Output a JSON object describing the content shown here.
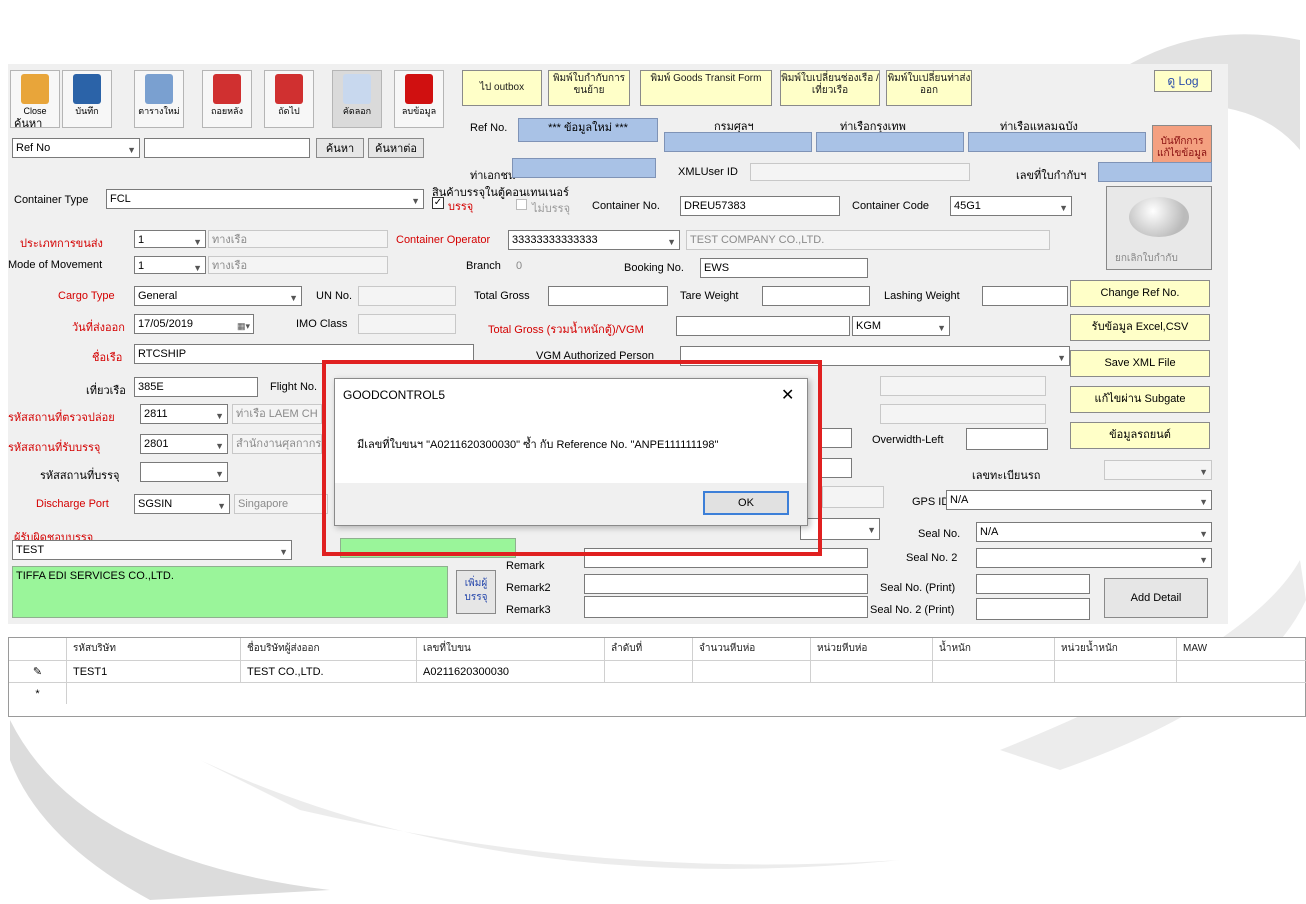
{
  "toolbar": [
    {
      "label": "Close",
      "icon": "close-folder-icon",
      "color": "#e8a53a"
    },
    {
      "label": "บันทึก",
      "icon": "save-icon",
      "color": "#2b63a8"
    },
    {
      "label": "ตารางใหม่",
      "icon": "edit-icon",
      "color": "#7aa0d0"
    },
    {
      "label": "ถอยหลัง",
      "icon": "back-arrow-icon",
      "color": "#d03030"
    },
    {
      "label": "ถัดไป",
      "icon": "next-arrow-icon",
      "color": "#d03030"
    },
    {
      "label": "คัดลอก",
      "icon": "copy-icon",
      "color": "#c8d8ee"
    },
    {
      "label": "ลบข้อมูล",
      "icon": "delete-x-icon",
      "color": "#d01010"
    }
  ],
  "top_buttons": {
    "outbox": "ไป outbox",
    "print_cargo": "พิมพ์ใบกำกับการขนย้าย",
    "print_goods_transit": "พิมพ์ Goods Transit Form",
    "print_change_port": "พิมพ์ใบเปลี่ยนช่องเรือ /เที่ยวเรือ",
    "print_change_exit": "พิมพ์ใบเปลี่ยนท่าส่งออก",
    "log": "ดู Log",
    "save_edit": "บันทึกการแก้ไขข้อมูล"
  },
  "search": {
    "label": "ค้นหา",
    "field": "Ref No",
    "value": "",
    "search_btn": "ค้นหา",
    "advanced_btn": "ค้นหาต่อ"
  },
  "header": {
    "ref_label": "Ref No.",
    "ref_value": "*** ข้อมูลใหม่ ***",
    "col1": "กรมศุลฯ",
    "col2": "ท่าเรือกรุงเทพ",
    "col3": "ท่าเรือแหลมฉบัง",
    "agent_label": "ท่าเอกชน",
    "xml_user_label": "XMLUser ID",
    "permit_label": "เลขที่ใบกำกับฯ"
  },
  "container": {
    "type_label": "Container Type",
    "type_value": "FCL",
    "goods_label": "สินค้าบรรจุในตู้คอนเทนเนอร์",
    "packed_label": "บรรจุ",
    "bulk_label": "ไม่บรรจุ",
    "no_label": "Container No.",
    "no_value": "DREU57383",
    "code_label": "Container Code",
    "code_value": "45G1",
    "cancel_label": "ยกเลิกใบกำกับ"
  },
  "form": {
    "transport_label": "ประเภทการขนส่ง",
    "transport_value": "1",
    "transport_desc": "ทางเรือ",
    "movement_label": "Mode of Movement",
    "movement_value": "1",
    "movement_desc": "ทางเรือ",
    "operator_label": "Container Operator",
    "operator_value": "33333333333333",
    "operator_name": "TEST COMPANY CO.,LTD.",
    "branch_label": "Branch",
    "branch_value": "0",
    "booking_label": "Booking No.",
    "booking_value": "EWS",
    "cargo_label": "Cargo Type",
    "cargo_value": "General",
    "un_label": "UN No.",
    "total_gross_label": "Total Gross",
    "tare_label": "Tare Weight",
    "lashing_label": "Lashing Weight",
    "date_label": "วันที่ส่งออก",
    "date_value": "17/05/2019",
    "imo_label": "IMO Class",
    "vgm_label": "Total Gross (รวมน้ำหนักตู้)/VGM",
    "vgm_unit": "KGM",
    "vessel_label": "ชื่อเรือ",
    "vessel_value": "RTCSHIP",
    "vgm_person_label": "VGM Authorized Person",
    "voyage_label": "เที่ยวเรือ",
    "voyage_value": "385E",
    "flight_label": "Flight No.",
    "load_port_label": "รหัสสถานที่ตรวจปล่อย",
    "load_port_value": "2811",
    "load_port_desc": "ท่าเรือ LAEM CH",
    "recv_port_label": "รหัสสถานที่รับบรรจุ",
    "recv_port_value": "2801",
    "recv_port_desc": "สำนักงานศุลกากร",
    "pack_place_label": "รหัสสถานที่บรรจุ",
    "discharge_label": "Discharge Port",
    "discharge_value": "SGSIN",
    "discharge_desc": "Singapore",
    "packer_label": "ผู้รับผิดชอบบรรจุ",
    "packer_value": "TEST",
    "company_value": "TIFFA EDI SERVICES CO.,LTD.",
    "add_packer": "เพิ่มผู้บรรจุ",
    "overwidth_label": "Overwidth-Left",
    "reg_label": "เลขทะเบียนรถ",
    "gps_label": "GPS ID",
    "gps_value": "N/A",
    "seal_label": "Seal No.",
    "seal_value": "N/A",
    "seal2_label": "Seal No. 2",
    "sealp_label": "Seal No. (Print)",
    "seal2p_label": "Seal No. 2 (Print)",
    "remark_label": "Remark",
    "remark2_label": "Remark2",
    "remark3_label": "Remark3",
    "add_detail": "Add Detail"
  },
  "right_buttons": [
    "Change Ref No.",
    "รับข้อมูล Excel,CSV",
    "Save XML File",
    "แก้ไขผ่าน Subgate",
    "ข้อมูลรถยนต์"
  ],
  "grid": {
    "columns": [
      "รหัสบริษัท",
      "ชื่อบริษัทผู้ส่งออก",
      "เลขที่ใบขน",
      "ลำดับที่",
      "จำนวนหีบห่อ",
      "หน่วยหีบห่อ",
      "น้ำหนัก",
      "หน่วยน้ำหนัก",
      "MAW"
    ],
    "row": [
      "TEST1",
      "TEST CO.,LTD.",
      "A0211620300030",
      "",
      "",
      "",
      "",
      "",
      ""
    ],
    "edit_marker": "✎",
    "new_marker": "*"
  },
  "dialog": {
    "title": "GOODCONTROL5",
    "message": "มีเลขที่ใบขนฯ \"A0211620300030\" ซ้ำ กับ Reference No. \"ANPE111111198\"",
    "ok": "OK",
    "close": "✕"
  },
  "colors": {
    "highlight": "#e02020",
    "field_blue": "#a9c2e6",
    "field_green": "#9af59a",
    "button_yellow": "#ffffc8"
  }
}
